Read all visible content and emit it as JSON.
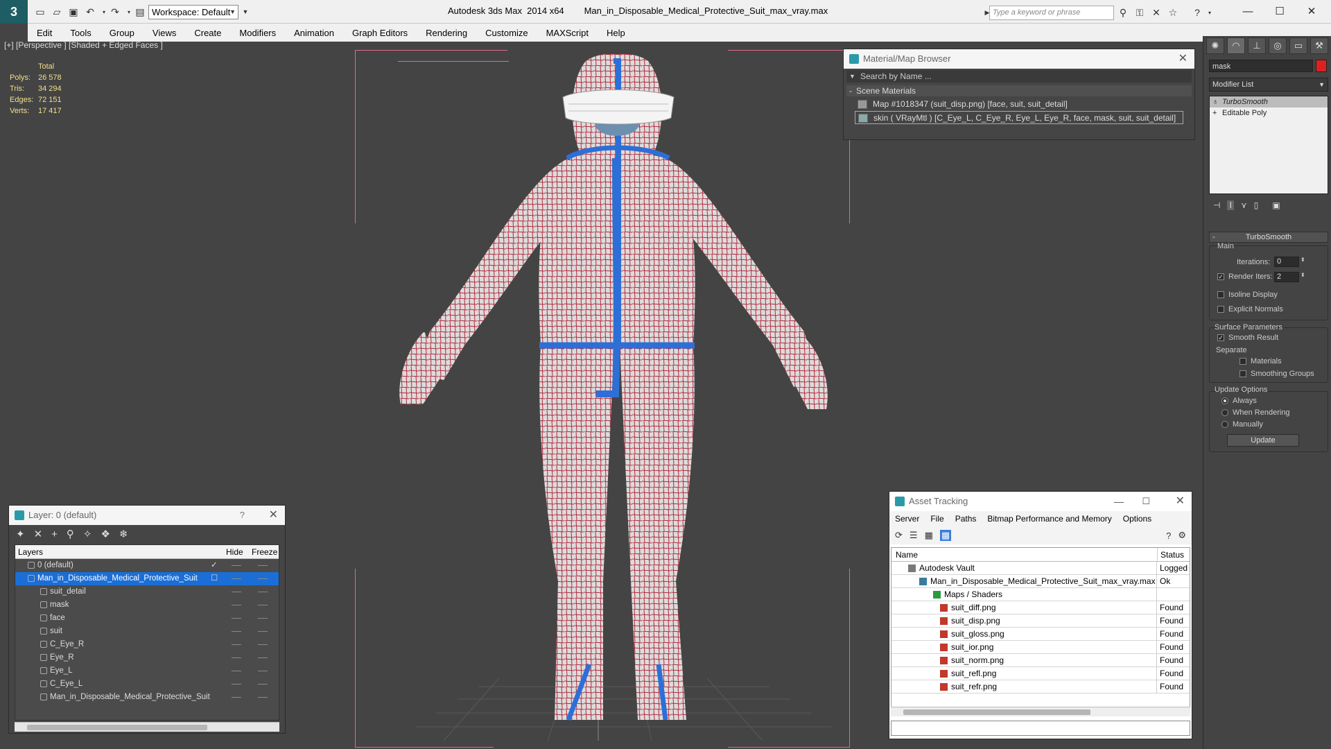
{
  "title_bar": {
    "workspace": "Workspace: Default",
    "app_name": "Autodesk 3ds Max  2014 x64",
    "file_name": "Man_in_Disposable_Medical_Protective_Suit_max_vray.max",
    "search_placeholder": "Type a keyword or phrase"
  },
  "menu": [
    "Edit",
    "Tools",
    "Group",
    "Views",
    "Create",
    "Modifiers",
    "Animation",
    "Graph Editors",
    "Rendering",
    "Customize",
    "MAXScript",
    "Help"
  ],
  "viewport": {
    "label": "[+] [Perspective ] [Shaded + Edged Faces ]",
    "stats": {
      "header": "Total",
      "rows": [
        {
          "k": "Polys:",
          "v": "26 578"
        },
        {
          "k": "Tris:",
          "v": "34 294"
        },
        {
          "k": "Edges:",
          "v": "72 151"
        },
        {
          "k": "Verts:",
          "v": "17 417"
        }
      ]
    }
  },
  "material_browser": {
    "title": "Material/Map Browser",
    "search": "Search by Name ...",
    "section": "Scene Materials",
    "items": [
      "Map #1018347 (suit_disp.png) [face, suit, suit_detail]",
      "skin  ( VRayMtl ) [C_Eye_L, C_Eye_R, Eye_L, Eye_R, face, mask, suit, suit_detail]"
    ]
  },
  "layer_panel": {
    "title": "Layer: 0 (default)",
    "help": "?",
    "cols": {
      "layers": "Layers",
      "hide": "Hide",
      "freeze": "Freeze"
    },
    "rows": [
      "0 (default)",
      "Man_in_Disposable_Medical_Protective_Suit",
      "suit_detail",
      "mask",
      "face",
      "suit",
      "C_Eye_R",
      "Eye_R",
      "Eye_L",
      "C_Eye_L",
      "Man_in_Disposable_Medical_Protective_Suit"
    ]
  },
  "asset_tracking": {
    "title": "Asset Tracking",
    "menu": [
      "Server",
      "File",
      "Paths",
      "Bitmap Performance and Memory",
      "Options"
    ],
    "cols": {
      "name": "Name",
      "status": "Status"
    },
    "rows": [
      {
        "name": "Autodesk Vault",
        "status": "Logged"
      },
      {
        "name": "Man_in_Disposable_Medical_Protective_Suit_max_vray.max",
        "status": "Ok"
      },
      {
        "name": "Maps / Shaders",
        "status": ""
      },
      {
        "name": "suit_diff.png",
        "status": "Found"
      },
      {
        "name": "suit_disp.png",
        "status": "Found"
      },
      {
        "name": "suit_gloss.png",
        "status": "Found"
      },
      {
        "name": "suit_ior.png",
        "status": "Found"
      },
      {
        "name": "suit_norm.png",
        "status": "Found"
      },
      {
        "name": "suit_refl.png",
        "status": "Found"
      },
      {
        "name": "suit_refr.png",
        "status": "Found"
      }
    ]
  },
  "command_panel": {
    "object_name": "mask",
    "modifier_list": "Modifier List",
    "stack": [
      "TurboSmooth",
      "Editable Poly"
    ],
    "rollout_title": "TurboSmooth",
    "main": "Main",
    "iterations_label": "Iterations:",
    "iterations": "0",
    "render_iters_label": "Render Iters:",
    "render_iters": "2",
    "isoline": "Isoline Display",
    "explicit": "Explicit Normals",
    "surface_params": "Surface Parameters",
    "smooth_result": "Smooth Result",
    "separate": "Separate",
    "materials": "Materials",
    "smoothing_groups": "Smoothing Groups",
    "update_options": "Update Options",
    "always": "Always",
    "when_rendering": "When Rendering",
    "manually": "Manually",
    "update_btn": "Update"
  }
}
